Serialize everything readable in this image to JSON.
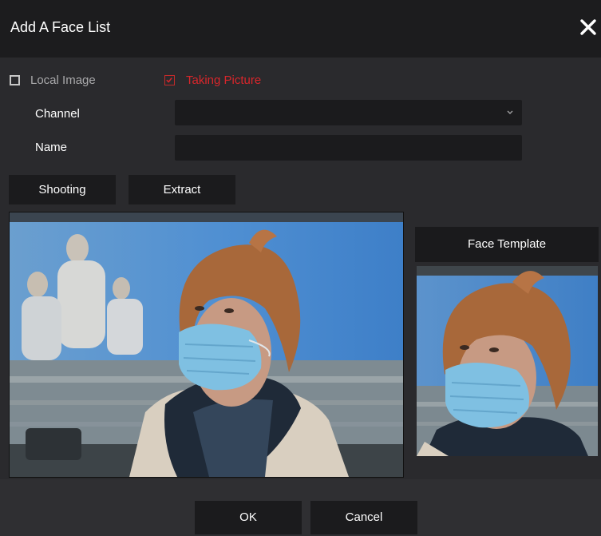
{
  "dialog": {
    "title": "Add A Face List",
    "close_icon": "close-icon"
  },
  "source": {
    "local_image_label": "Local Image",
    "local_image_checked": false,
    "taking_picture_label": "Taking Picture",
    "taking_picture_checked": true,
    "accent_color": "#d8262b"
  },
  "form": {
    "channel_label": "Channel",
    "channel_value": "",
    "name_label": "Name",
    "name_value": ""
  },
  "actions": {
    "shooting_label": "Shooting",
    "extract_label": "Extract"
  },
  "template": {
    "heading": "Face Template"
  },
  "footer": {
    "ok_label": "OK",
    "cancel_label": "Cancel"
  }
}
